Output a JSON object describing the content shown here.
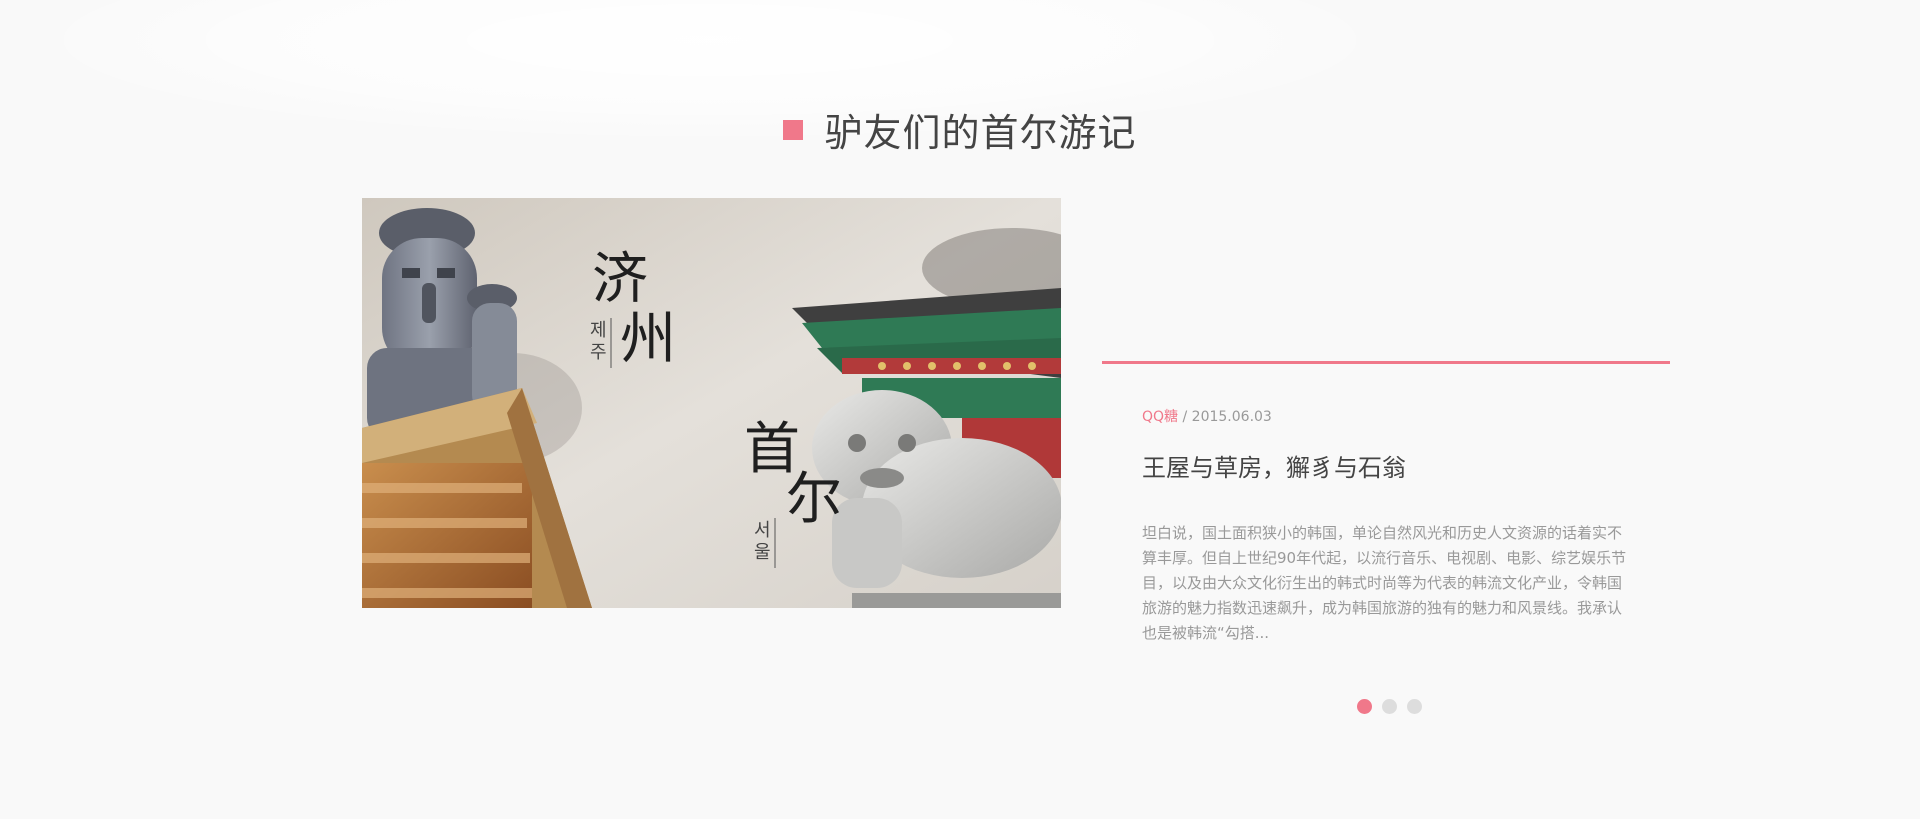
{
  "section": {
    "title": "驴友们的首尔游记"
  },
  "photo": {
    "caption_top_han": "济州",
    "caption_top_kr": "제주",
    "caption_bottom_han": "首尔",
    "caption_bottom_kr": "서울"
  },
  "article": {
    "author": "QQ糖",
    "separator": " / ",
    "date": "2015.06.03",
    "title": "王屋与草房，獬豸与石翁",
    "excerpt": "坦白说，国土面积狭小的韩国，单论自然风光和历史人文资源的话着实不算丰厚。但自上世纪90年代起，以流行音乐、电视剧、电影、综艺娱乐节目，以及由大众文化衍生出的韩式时尚等为代表的韩流文化产业，令韩国旅游的魅力指数迅速飙升，成为韩国旅游的独有的魅力和风景线。我承认也是被韩流“勾搭..."
  },
  "pagination": {
    "count": 3,
    "active_index": 0
  },
  "colors": {
    "accent": "#f0788a",
    "inactive_dot": "#dddddd",
    "background": "#f9f9f9"
  }
}
